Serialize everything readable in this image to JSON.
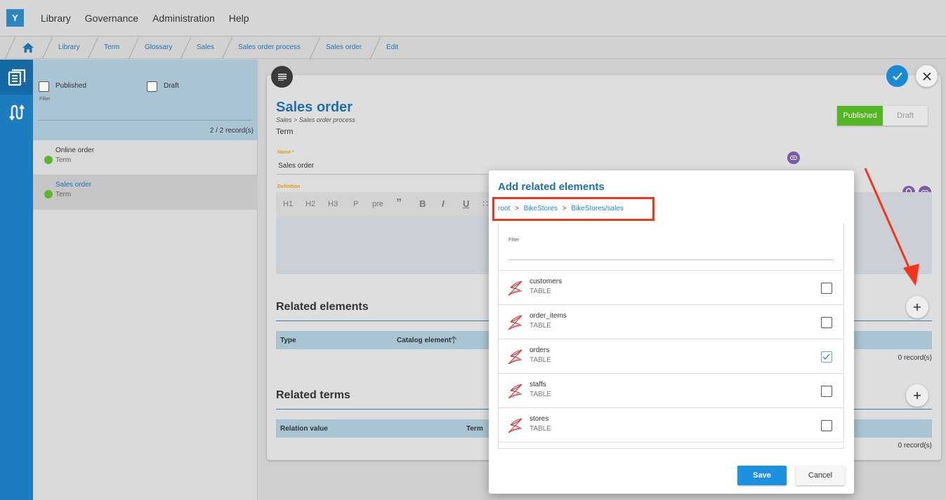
{
  "app": {
    "logo_letter": "Y"
  },
  "topmenu": [
    "Library",
    "Governance",
    "Administration",
    "Help"
  ],
  "breadcrumb": [
    "Library",
    "Term",
    "Glossary",
    "Sales",
    "Sales order process",
    "Sales order",
    "Edit"
  ],
  "sidebar": {
    "filter": {
      "published_label": "Published",
      "draft_label": "Draft",
      "filter_label": "Filter",
      "record_count": "2 / 2 record(s)"
    },
    "items": [
      {
        "name": "Online order",
        "type": "Term",
        "status_color": "#5ab52a"
      },
      {
        "name": "Sales order",
        "type": "Term",
        "status_color": "#5ab52a"
      }
    ]
  },
  "detail": {
    "title": "Sales order",
    "path": "Sales >  Sales order process",
    "type": "Term",
    "status_published": "Published",
    "status_draft": "Draft",
    "name_label": "Name *",
    "name_value": "Sales order",
    "definition_label": "Definition",
    "toolbar": [
      "H1",
      "H2",
      "H3",
      "P",
      "pre",
      "”",
      "B",
      "I",
      "U",
      "∷"
    ],
    "related_elements": {
      "title": "Related elements",
      "col_type": "Type",
      "col_catalog": "Catalog element",
      "records": "0 record(s)"
    },
    "related_terms": {
      "title": "Related terms",
      "col_relation": "Relation value",
      "col_term": "Term",
      "records": "0 record(s)"
    }
  },
  "modal": {
    "title": "Add related elements",
    "path": [
      "root",
      ">",
      "BikeStores",
      ">",
      "BikeStores/sales"
    ],
    "filter_label": "Filter",
    "rows": [
      {
        "name": "customers",
        "kind": "TABLE",
        "checked": false
      },
      {
        "name": "order_items",
        "kind": "TABLE",
        "checked": false
      },
      {
        "name": "orders",
        "kind": "TABLE",
        "checked": true
      },
      {
        "name": "staffs",
        "kind": "TABLE",
        "checked": false
      },
      {
        "name": "stores",
        "kind": "TABLE",
        "checked": false
      }
    ],
    "save_label": "Save",
    "cancel_label": "Cancel"
  },
  "colors": {
    "accent": "#1a73b5",
    "published": "#52b522",
    "annotation": "#f2361b",
    "save": "#1e90e0",
    "badge": "#7b5ca8"
  },
  "icons": [
    "home-icon",
    "library-icon",
    "lineage-icon",
    "menu-icon",
    "check-icon",
    "close-icon",
    "plus-icon",
    "bulb-icon",
    "link-icon",
    "sql-server-icon",
    "sort-arrow-icon"
  ]
}
